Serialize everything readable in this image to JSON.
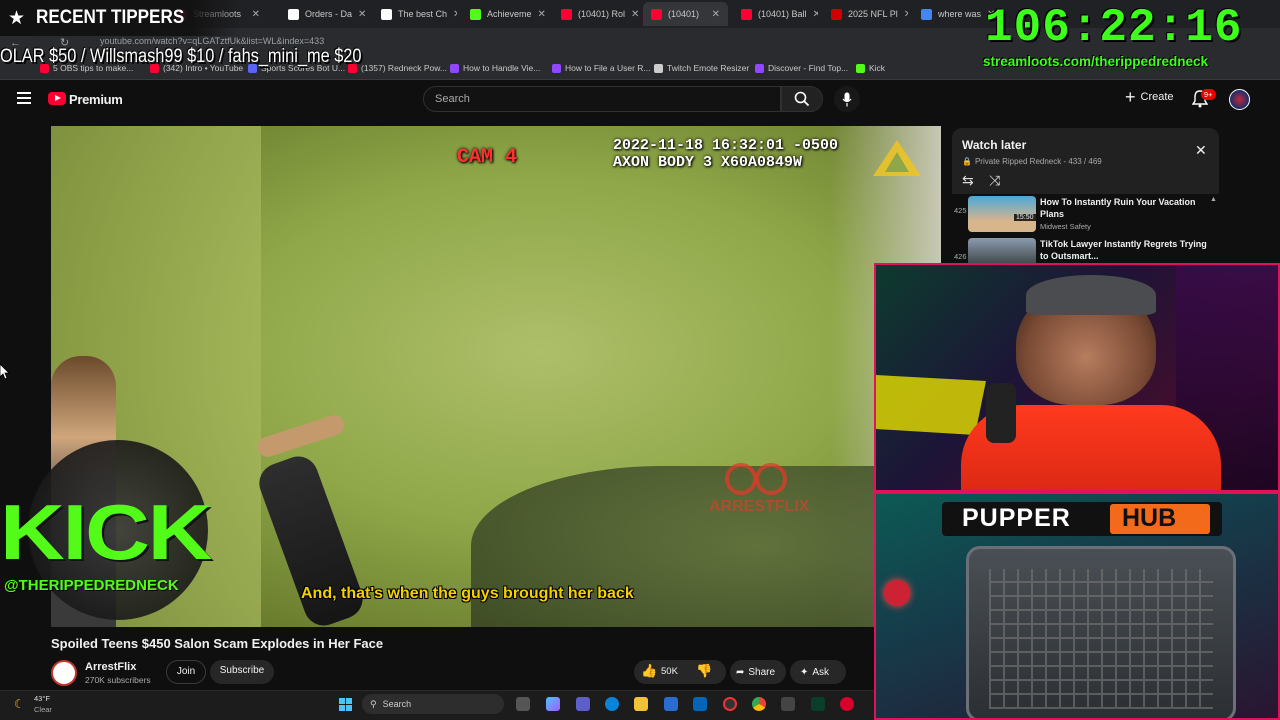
{
  "overlay": {
    "recent_tippers_label": "RECENT TIPPERS",
    "tippers_ticker": "OLAR $50 / Willsmash99 $10 / fahs_mini_me $20",
    "timer": "106:22:16",
    "streamloots_url": "streamloots.com/therippedredneck",
    "kick_logo_text": "KICK",
    "kick_handle": "@THERIPPEDREDNECK",
    "pupper_label": "PUPPER",
    "hub_label": "HUB"
  },
  "browser": {
    "url": "youtube.com/watch?v=qLGATztfUk&list=WL&index=433",
    "tabs": [
      {
        "label": "Streamloots",
        "color": "#ff2a55"
      },
      {
        "label": "Orders - Da",
        "color": "#ffffff"
      },
      {
        "label": "The best Ch",
        "color": "#ffffff"
      },
      {
        "label": "Achieveme",
        "color": "#53fc18"
      },
      {
        "label": "(10401) Rol",
        "color": "#ff0033"
      },
      {
        "label": "(10401)",
        "color": "#ff0033"
      },
      {
        "label": "(10401) Ball",
        "color": "#ff0033"
      },
      {
        "label": "2025 NFL Pl",
        "color": "#d00000"
      },
      {
        "label": "where was",
        "color": "#4285f4"
      }
    ],
    "bookmarks": [
      {
        "label": "5 OBS tips to make...",
        "color": "#ff0033"
      },
      {
        "label": "(342) Intro • YouTube",
        "color": "#ff0033"
      },
      {
        "label": "Sports Scores Bot U...",
        "color": "#5865f2"
      },
      {
        "label": "(1357) Redneck Pow...",
        "color": "#ff0033"
      },
      {
        "label": "How to Handle Vie...",
        "color": "#9147ff"
      },
      {
        "label": "How to File a User R...",
        "color": "#9147ff"
      },
      {
        "label": "Twitch Emote Resizer",
        "color": "#cccccc"
      },
      {
        "label": "Discover - Find Top...",
        "color": "#9147ff"
      },
      {
        "label": "Kick",
        "color": "#53fc18"
      }
    ]
  },
  "youtube": {
    "logo_label": "Premium",
    "search_placeholder": "Search",
    "create_label": "Create",
    "notification_badge": "9+",
    "video_title": "Spoiled Teens $450 Salon Scam Explodes in Her Face",
    "channel_name": "ArrestFlix",
    "subscribers": "270K subscribers",
    "join_label": "Join",
    "subscribe_label": "Subscribe",
    "likes": "50K",
    "share_label": "Share",
    "ask_label": "Ask",
    "bodycam_timestamp": "2022-11-18 16:32:01 -0500",
    "bodycam_device": "AXON BODY 3 X60A0849W",
    "cam_label": "CAM 4",
    "subtitle": "And, that's when the guys brought her back",
    "watermark": "ARRESTFLIX"
  },
  "watch_later": {
    "title": "Watch later",
    "meta": "Private  Ripped Redneck - 433 / 469",
    "items": [
      {
        "index": "425",
        "title": "How To Instantly Ruin Your Vacation Plans",
        "channel": "Midwest Safety",
        "duration": "15:50"
      },
      {
        "index": "426",
        "title": "TikTok Lawyer Instantly Regrets Trying to Outsmart...",
        "channel": "",
        "duration": "24:10"
      }
    ]
  },
  "taskbar": {
    "weather_temp": "43°F",
    "weather_desc": "Clear",
    "search_label": "Search"
  }
}
